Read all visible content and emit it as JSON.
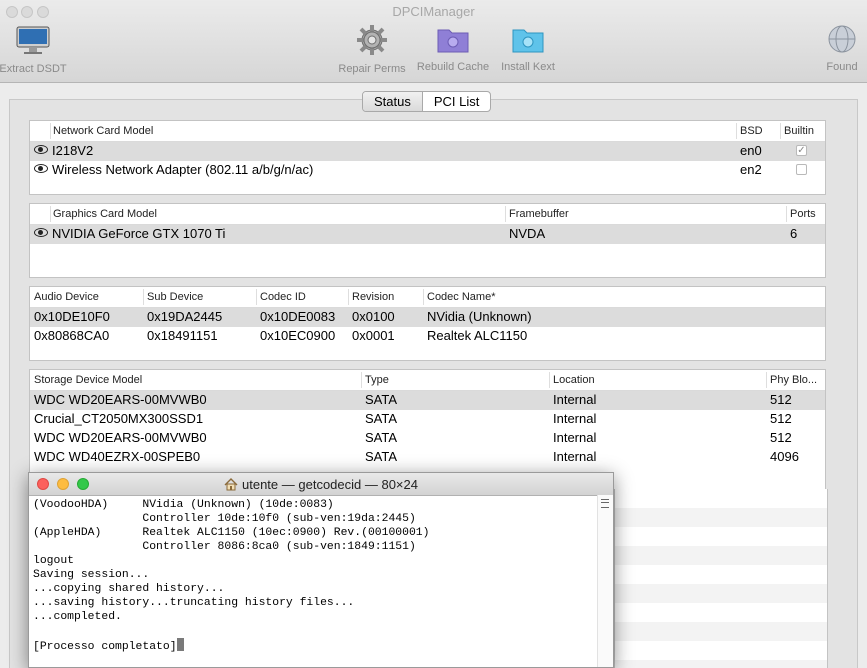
{
  "window": {
    "title": "DPCIManager"
  },
  "toolbar": {
    "extract_dsdt": "Extract DSDT",
    "repair_perms": "Repair Perms",
    "rebuild_cache": "Rebuild Cache",
    "install_kext": "Install Kext",
    "found": "Found"
  },
  "tabs": {
    "status": "Status",
    "pci_list": "PCI List"
  },
  "network": {
    "headers": {
      "model": "Network Card Model",
      "bsd": "BSD",
      "builtin": "Builtin"
    },
    "rows": [
      {
        "model": "I218V2",
        "bsd": "en0",
        "builtin": true
      },
      {
        "model": "Wireless Network Adapter (802.11 a/b/g/n/ac)",
        "bsd": "en2",
        "builtin": false
      }
    ]
  },
  "graphics": {
    "headers": {
      "model": "Graphics Card Model",
      "framebuffer": "Framebuffer",
      "ports": "Ports"
    },
    "rows": [
      {
        "model": "NVIDIA GeForce GTX 1070 Ti",
        "framebuffer": "NVDA",
        "ports": "6"
      }
    ]
  },
  "audio": {
    "headers": {
      "device": "Audio Device",
      "sub": "Sub Device",
      "codec_id": "Codec ID",
      "revision": "Revision",
      "codec_name": "Codec Name*"
    },
    "rows": [
      {
        "device": "0x10DE10F0",
        "sub": "0x19DA2445",
        "codec_id": "0x10DE0083",
        "revision": "0x0100",
        "codec_name": "NVidia (Unknown)"
      },
      {
        "device": "0x80868CA0",
        "sub": "0x18491151",
        "codec_id": "0x10EC0900",
        "revision": "0x0001",
        "codec_name": "Realtek ALC1150"
      }
    ]
  },
  "storage": {
    "headers": {
      "model": "Storage Device Model",
      "type": "Type",
      "location": "Location",
      "phy": "Phy Blo..."
    },
    "rows": [
      {
        "model": "WDC WD20EARS-00MVWB0",
        "type": "SATA",
        "location": "Internal",
        "phy": "512"
      },
      {
        "model": "Crucial_CT2050MX300SSD1",
        "type": "SATA",
        "location": "Internal",
        "phy": "512"
      },
      {
        "model": "WDC WD20EARS-00MVWB0",
        "type": "SATA",
        "location": "Internal",
        "phy": "512"
      },
      {
        "model": "WDC WD40EZRX-00SPEB0",
        "type": "SATA",
        "location": "Internal",
        "phy": "4096"
      }
    ]
  },
  "terminal": {
    "title": "utente — getcodecid — 80×24",
    "lines": [
      "(VoodooHDA)     NVidia (Unknown) (10de:0083)",
      "                Controller 10de:10f0 (sub-ven:19da:2445)",
      "(AppleHDA)      Realtek ALC1150 (10ec:0900) Rev.(00100001)",
      "                Controller 8086:8ca0 (sub-ven:1849:1151)",
      "logout",
      "Saving session...",
      "...copying shared history...",
      "...saving history...truncating history files...",
      "...completed.",
      "",
      "[Processo completato]"
    ]
  },
  "colors": {
    "close": "#fc605c",
    "minimize": "#fdbc40",
    "zoom": "#34c84a",
    "selected_row": "#dcdcdc"
  }
}
